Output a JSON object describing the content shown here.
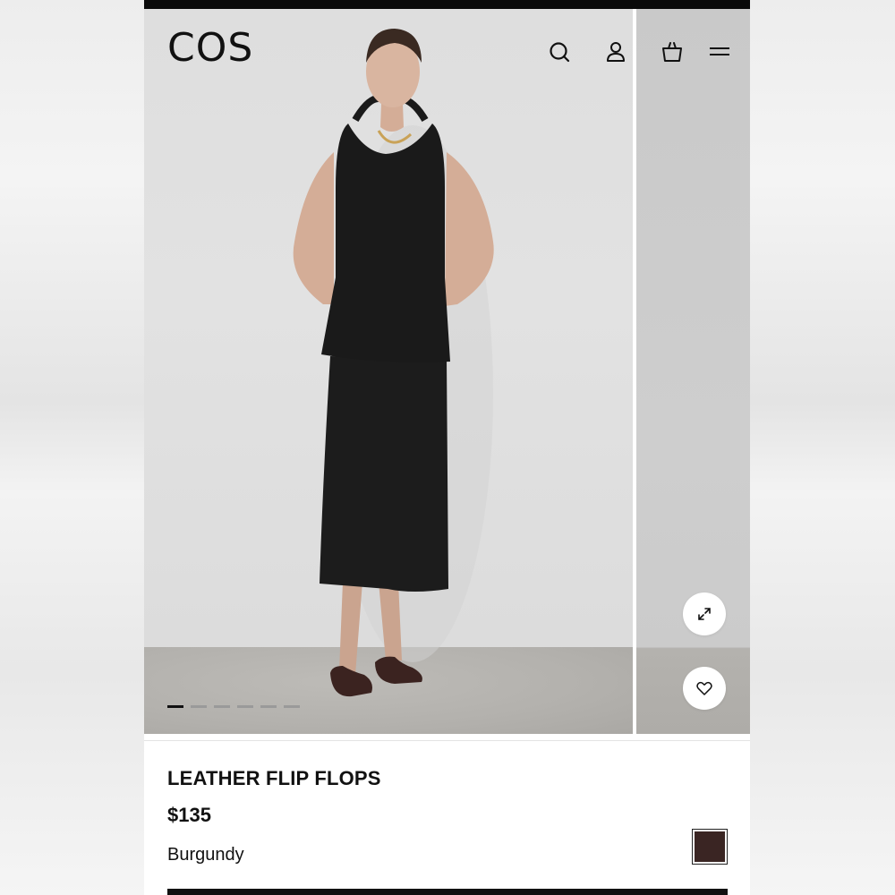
{
  "brand": {
    "logo": "COS"
  },
  "header": {
    "icons": [
      "search-icon",
      "account-icon",
      "bag-icon",
      "menu-icon"
    ]
  },
  "gallery": {
    "image_count": 6,
    "active_index": 0,
    "expand_icon": "expand-icon",
    "wishlist_icon": "heart-icon"
  },
  "product": {
    "name": "LEATHER FLIP FLOPS",
    "price": "$135",
    "color": "Burgundy",
    "swatch_color": "#3a2523"
  },
  "colors": {
    "text": "#111111",
    "background": "#ffffff"
  }
}
